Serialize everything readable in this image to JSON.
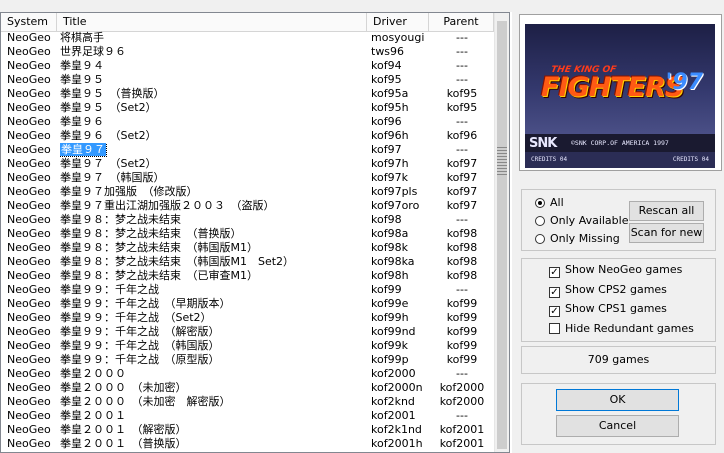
{
  "columns": {
    "system": "System",
    "title": "Title",
    "driver": "Driver",
    "parent": "Parent"
  },
  "rows": [
    {
      "system": "NeoGeo",
      "title": "将棋高手",
      "driver": "mosyougi",
      "parent": "---"
    },
    {
      "system": "NeoGeo",
      "title": "世界足球９６",
      "driver": "tws96",
      "parent": "---"
    },
    {
      "system": "NeoGeo",
      "title": "拳皇９４",
      "driver": "kof94",
      "parent": "---"
    },
    {
      "system": "NeoGeo",
      "title": "拳皇９５",
      "driver": "kof95",
      "parent": "---"
    },
    {
      "system": "NeoGeo",
      "title": "拳皇９５　（普换版）",
      "driver": "kof95a",
      "parent": "kof95"
    },
    {
      "system": "NeoGeo",
      "title": "拳皇９５　（Set2）",
      "driver": "kof95h",
      "parent": "kof95"
    },
    {
      "system": "NeoGeo",
      "title": "拳皇９６",
      "driver": "kof96",
      "parent": "---"
    },
    {
      "system": "NeoGeo",
      "title": "拳皇９６　（Set2）",
      "driver": "kof96h",
      "parent": "kof96"
    },
    {
      "system": "NeoGeo",
      "title": "拳皇９７",
      "driver": "kof97",
      "parent": "---",
      "selected": true
    },
    {
      "system": "NeoGeo",
      "title": "拳皇９７　（Set2）",
      "driver": "kof97h",
      "parent": "kof97"
    },
    {
      "system": "NeoGeo",
      "title": "拳皇９７　（韩国版）",
      "driver": "kof97k",
      "parent": "kof97"
    },
    {
      "system": "NeoGeo",
      "title": "拳皇９７加强版　（修改版）",
      "driver": "kof97pls",
      "parent": "kof97"
    },
    {
      "system": "NeoGeo",
      "title": "拳皇９７重出江湖加强版２００３　（盗版）",
      "driver": "kof97oro",
      "parent": "kof97"
    },
    {
      "system": "NeoGeo",
      "title": "拳皇９８：梦之战未结束",
      "driver": "kof98",
      "parent": "---"
    },
    {
      "system": "NeoGeo",
      "title": "拳皇９８：梦之战未结束　（普换版）",
      "driver": "kof98a",
      "parent": "kof98"
    },
    {
      "system": "NeoGeo",
      "title": "拳皇９８：梦之战未结束　（韩国版M1）",
      "driver": "kof98k",
      "parent": "kof98"
    },
    {
      "system": "NeoGeo",
      "title": "拳皇９８：梦之战未结束　（韩国版M1　Set2）",
      "driver": "kof98ka",
      "parent": "kof98"
    },
    {
      "system": "NeoGeo",
      "title": "拳皇９８：梦之战未结束　（已审查M1）",
      "driver": "kof98h",
      "parent": "kof98"
    },
    {
      "system": "NeoGeo",
      "title": "拳皇９９：千年之战",
      "driver": "kof99",
      "parent": "---"
    },
    {
      "system": "NeoGeo",
      "title": "拳皇９９：千年之战　（早期版本）",
      "driver": "kof99e",
      "parent": "kof99"
    },
    {
      "system": "NeoGeo",
      "title": "拳皇９９：千年之战　（Set2）",
      "driver": "kof99h",
      "parent": "kof99"
    },
    {
      "system": "NeoGeo",
      "title": "拳皇９９：千年之战　（解密版）",
      "driver": "kof99nd",
      "parent": "kof99"
    },
    {
      "system": "NeoGeo",
      "title": "拳皇９９：千年之战　（韩国版）",
      "driver": "kof99k",
      "parent": "kof99"
    },
    {
      "system": "NeoGeo",
      "title": "拳皇９９：千年之战　（原型版）",
      "driver": "kof99p",
      "parent": "kof99"
    },
    {
      "system": "NeoGeo",
      "title": "拳皇２０００",
      "driver": "kof2000",
      "parent": "---"
    },
    {
      "system": "NeoGeo",
      "title": "拳皇２０００　（未加密）",
      "driver": "kof2000n",
      "parent": "kof2000"
    },
    {
      "system": "NeoGeo",
      "title": "拳皇２０００　（未加密　解密版）",
      "driver": "kof2knd",
      "parent": "kof2000"
    },
    {
      "system": "NeoGeo",
      "title": "拳皇２００１",
      "driver": "kof2001",
      "parent": "---"
    },
    {
      "system": "NeoGeo",
      "title": "拳皇２００１　（解密版）",
      "driver": "kof2k1nd",
      "parent": "kof2001"
    },
    {
      "system": "NeoGeo",
      "title": "拳皇２００１　（普换版）",
      "driver": "kof2001h",
      "parent": "kof2001"
    }
  ],
  "preview": {
    "logo_the": "THE KING OF",
    "logo_main": "FIGHTERS",
    "logo_year": "'97",
    "brand": "SNK",
    "copyright": "©SNK CORP.OF AMERICA 1997",
    "credits_left": "CREDITS 04",
    "credits_right": "CREDITS 04"
  },
  "filter": {
    "options": [
      {
        "label": "All",
        "selected": true
      },
      {
        "label": "Only Available",
        "selected": false
      },
      {
        "label": "Only Missing",
        "selected": false
      }
    ],
    "rescan_label": "Rescan all",
    "scan_new_label": "Scan for new"
  },
  "show_options": [
    {
      "label": "Show NeoGeo games",
      "checked": true
    },
    {
      "label": "Show CPS2 games",
      "checked": true
    },
    {
      "label": "Show CPS1 games",
      "checked": true
    },
    {
      "label": "Hide Redundant games",
      "checked": false
    }
  ],
  "game_count": "709 games",
  "ok_label": "OK",
  "cancel_label": "Cancel",
  "colors": {
    "selection": "#3399ff",
    "ok_border": "#0078d7"
  }
}
